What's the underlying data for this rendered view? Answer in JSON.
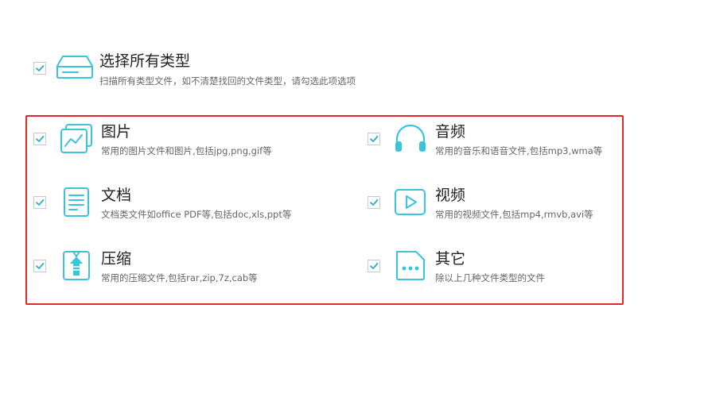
{
  "select_all": {
    "title": "选择所有类型",
    "desc": "扫描所有类型文件，如不清楚找回的文件类型，请勾选此项选项",
    "icon": "disk-drive-icon",
    "checked": true
  },
  "types": [
    {
      "key": "picture",
      "title": "图片",
      "desc": "常用的图片文件和图片,包括jpg,png,gif等",
      "icon": "picture-icon",
      "checked": true
    },
    {
      "key": "audio",
      "title": "音频",
      "desc": "常用的音乐和语音文件,包括mp3,wma等",
      "icon": "headphones-icon",
      "checked": true
    },
    {
      "key": "document",
      "title": "文档",
      "desc": "文档类文件如office PDF等,包括doc,xls,ppt等",
      "icon": "document-icon",
      "checked": true
    },
    {
      "key": "video",
      "title": "视频",
      "desc": "常用的视频文件,包括mp4,rmvb,avi等",
      "icon": "play-icon",
      "checked": true
    },
    {
      "key": "archive",
      "title": "压缩",
      "desc": "常用的压缩文件,包括rar,zip,7z,cab等",
      "icon": "zip-archive-icon",
      "checked": true
    },
    {
      "key": "other",
      "title": "其它",
      "desc": "除以上几种文件类型的文件",
      "icon": "more-file-icon",
      "checked": true
    }
  ],
  "colors": {
    "accent": "#3cc3dc",
    "check": "#2fa9c9",
    "highlight_border": "#e02a22"
  }
}
